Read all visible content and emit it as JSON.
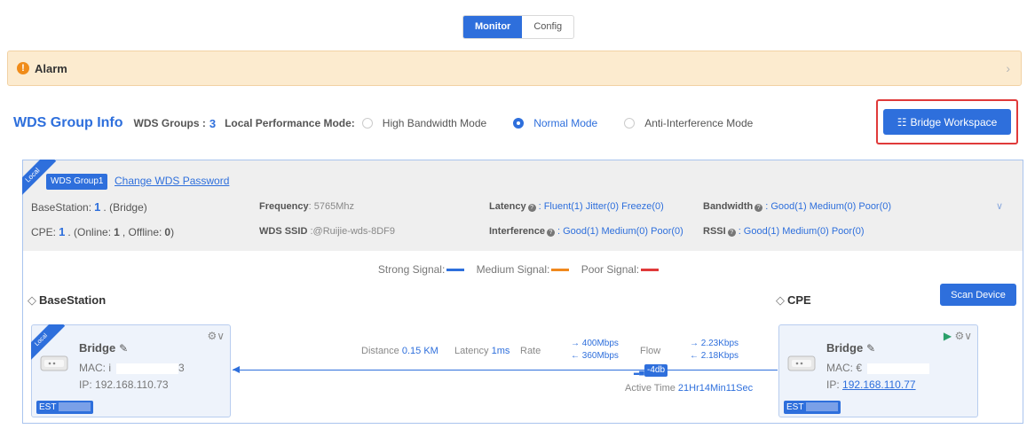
{
  "tabs": [
    {
      "label": "Monitor",
      "active": true
    },
    {
      "label": "Config",
      "active": false
    }
  ],
  "alarm": {
    "title": "Alarm"
  },
  "group_info": {
    "title": "WDS Group Info",
    "groups_label": "WDS Groups :",
    "groups_count": "3",
    "perf_label": "Local Performance Mode:",
    "modes": [
      {
        "label": "High Bandwidth Mode",
        "selected": false
      },
      {
        "label": "Normal Mode",
        "selected": true
      },
      {
        "label": "Anti-Interference Mode",
        "selected": false
      }
    ],
    "bridge_workspace_label": "Bridge Workspace"
  },
  "panel": {
    "ribbon": "Local",
    "group_tag": "WDS Group1",
    "change_pwd": "Change WDS Password",
    "basestation_label": "BaseStation:",
    "basestation_count": "1",
    "basestation_suffix": ". (Bridge)",
    "cpe_label": "CPE:",
    "cpe_count": "1",
    "cpe_online_prefix": ". (Online:",
    "cpe_online": "1",
    "cpe_offline_mid": ", Offline:",
    "cpe_offline_value": "0",
    "cpe_offline_close": ")",
    "frequency_label": "Frequency",
    "frequency_value": ": 5765Mhz",
    "ssid_label": "WDS SSID",
    "ssid_value": ":@Ruijie-wds-8DF9",
    "latency_label": "Latency",
    "latency_value": ": Fluent(1)  Jitter(0)  Freeze(0)",
    "interference_label": "Interference",
    "interference_value": ": Good(1)  Medium(0)  Poor(0)",
    "bandwidth_label": "Bandwidth",
    "bandwidth_value": ": Good(1)  Medium(0)  Poor(0)",
    "rssi_label": "RSSI",
    "rssi_value": ": Good(1)  Medium(0)  Poor(0)"
  },
  "legend": {
    "strong": "Strong Signal:",
    "medium": "Medium Signal:",
    "poor": "Poor Signal:",
    "strong_color": "#2e6fdc",
    "medium_color": "#f0891e",
    "poor_color": "#e03a3a"
  },
  "basestation": {
    "title": "BaseStation",
    "ribbon": "Local",
    "name": "Bridge",
    "mac_label": "MAC:",
    "mac_fragment": "i",
    "mac_tail": "3",
    "ip_label": "IP:",
    "ip": "192.168.110.73",
    "est": "EST"
  },
  "cpe": {
    "title": "CPE",
    "scan_label": "Scan Device",
    "name": "Bridge",
    "mac_label": "MAC:",
    "mac_fragment": "€",
    "ip_label": "IP:",
    "ip": "192.168.110.77",
    "est": "EST"
  },
  "link": {
    "distance_label": "Distance",
    "distance_value": "0.15 KM",
    "latency_label": "Latency",
    "latency_value": "1ms",
    "rate_label": "Rate",
    "rate_up": "400Mbps",
    "rate_down": "360Mbps",
    "flow_label": "Flow",
    "flow_up": "2.23Kbps",
    "flow_down": "2.18Kbps",
    "db": "-4db",
    "active_label": "Active Time",
    "active_value": "21Hr14Min11Sec"
  },
  "icons": {
    "alarm": "warning-circle-icon",
    "workspace": "grid-icon",
    "edit": "edit-icon",
    "gear": "gear-icon",
    "signal": "signal-icon"
  }
}
